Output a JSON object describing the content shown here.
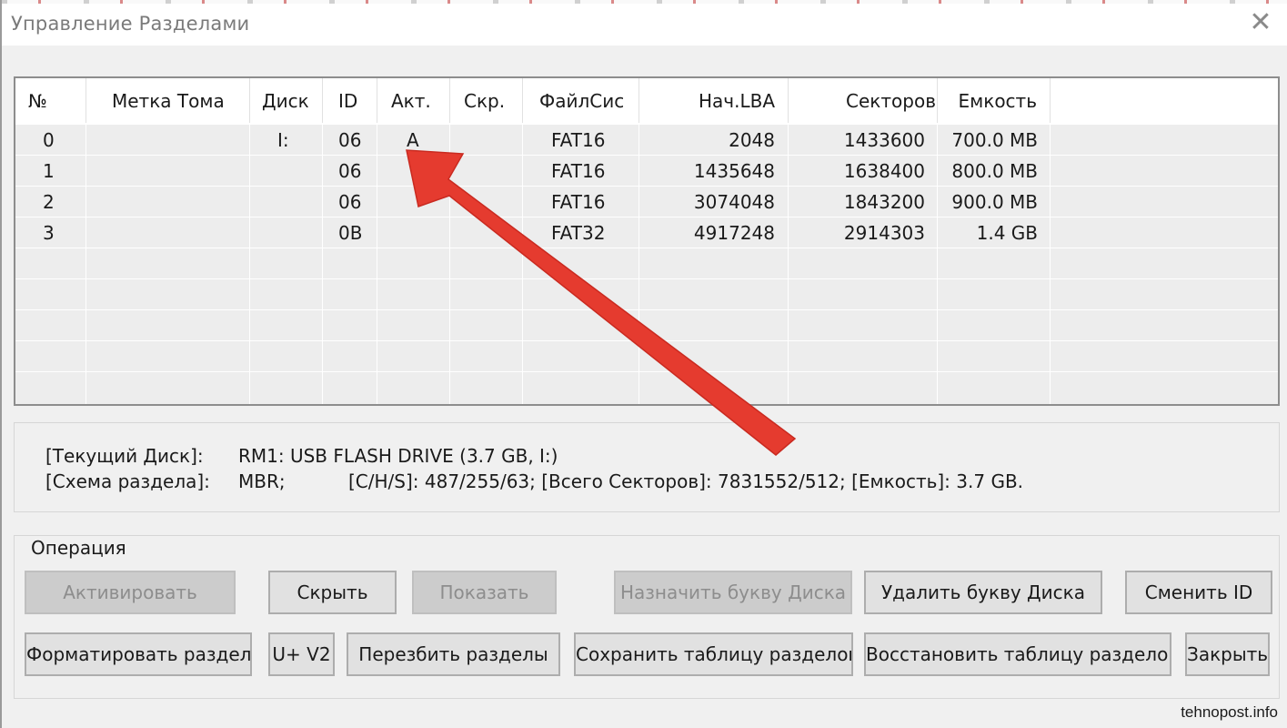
{
  "window": {
    "title": "Управление Разделами",
    "close_glyph": "✕"
  },
  "table": {
    "columns": [
      "№",
      "Метка Тома",
      "Диск",
      "ID",
      "Акт.",
      "Скр.",
      "ФайлСис",
      "Нач.LBA",
      "Секторов",
      "Емкость"
    ],
    "rows": [
      {
        "num": "0",
        "label": "",
        "disk": "I:",
        "id": "06",
        "active": "A",
        "hidden": "",
        "fs": "FAT16",
        "start_lba": "2048",
        "sectors": "1433600",
        "capacity": "700.0 MB"
      },
      {
        "num": "1",
        "label": "",
        "disk": "",
        "id": "06",
        "active": "",
        "hidden": "",
        "fs": "FAT16",
        "start_lba": "1435648",
        "sectors": "1638400",
        "capacity": "800.0 MB"
      },
      {
        "num": "2",
        "label": "",
        "disk": "",
        "id": "06",
        "active": "",
        "hidden": "",
        "fs": "FAT16",
        "start_lba": "3074048",
        "sectors": "1843200",
        "capacity": "900.0 MB"
      },
      {
        "num": "3",
        "label": "",
        "disk": "",
        "id": "0B",
        "active": "",
        "hidden": "",
        "fs": "FAT32",
        "start_lba": "4917248",
        "sectors": "2914303",
        "capacity": "1.4 GB"
      }
    ]
  },
  "info": {
    "current_disk_label": "[Текущий Диск]:",
    "current_disk_value": "RM1:  USB FLASH DRIVE (3.7 GB, I:)",
    "scheme_label": "[Схема раздела]:",
    "scheme_value": "MBR;",
    "geometry": "[C/H/S]: 487/255/63; [Всего Секторов]: 7831552/512; [Емкость]: 3.7 GB."
  },
  "operations": {
    "legend": "Операция",
    "activate": "Активировать",
    "hide": "Скрыть",
    "show": "Показать",
    "assign_letter": "Назначить букву Диска",
    "remove_letter": "Удалить букву Диска",
    "change_id": "Сменить ID",
    "format": "Форматировать раздел",
    "u_v2": "U+ V2",
    "repartition": "Перезбить разделы",
    "save_table": "Сохранить таблицу разделов",
    "restore_table": "Восстановить таблицу разделов",
    "close": "Закрыть"
  },
  "annotation": {
    "arrow_color": "#e53b2f"
  },
  "watermark": "tehnopost.info"
}
